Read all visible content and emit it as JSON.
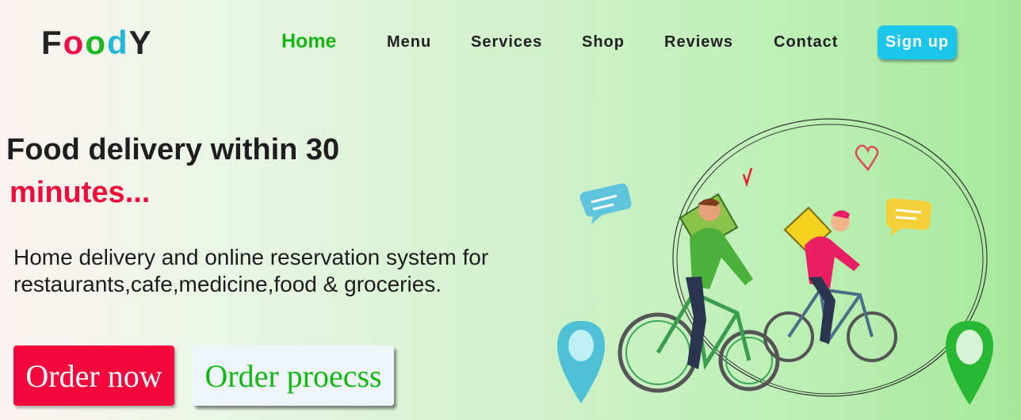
{
  "logo": {
    "letters": [
      {
        "char": "F",
        "color": "#222222"
      },
      {
        "char": "o",
        "color": "#f00d49"
      },
      {
        "char": "o",
        "color": "#1ab823"
      },
      {
        "char": "d",
        "color": "#26b7d6"
      },
      {
        "char": "Y",
        "color": "#222222"
      }
    ]
  },
  "nav": {
    "items": [
      "Home",
      "Menu",
      "Services",
      "Shop",
      "Reviews",
      "Contact"
    ],
    "active": "Home",
    "signup_label": "Sign up"
  },
  "hero": {
    "headline": "Food delivery within 30",
    "subheadline": "minutes...",
    "description": "Home delivery and online reservation system for restaurants,cafe,medicine,food & groceries.",
    "order_now_label": "Order now",
    "order_process_label": "Order proecss"
  },
  "colors": {
    "accent_green": "#18b614",
    "accent_red": "#ee0c3a",
    "signup_blue": "#1cc6ea",
    "order_button_red": "#f4073c"
  },
  "illustration": {
    "icons": [
      "chat-bubble-icon",
      "heart-icon",
      "check-mark-icon",
      "location-pin-icon",
      "delivery-bicycle-icon",
      "delivery-rider-icon"
    ]
  }
}
